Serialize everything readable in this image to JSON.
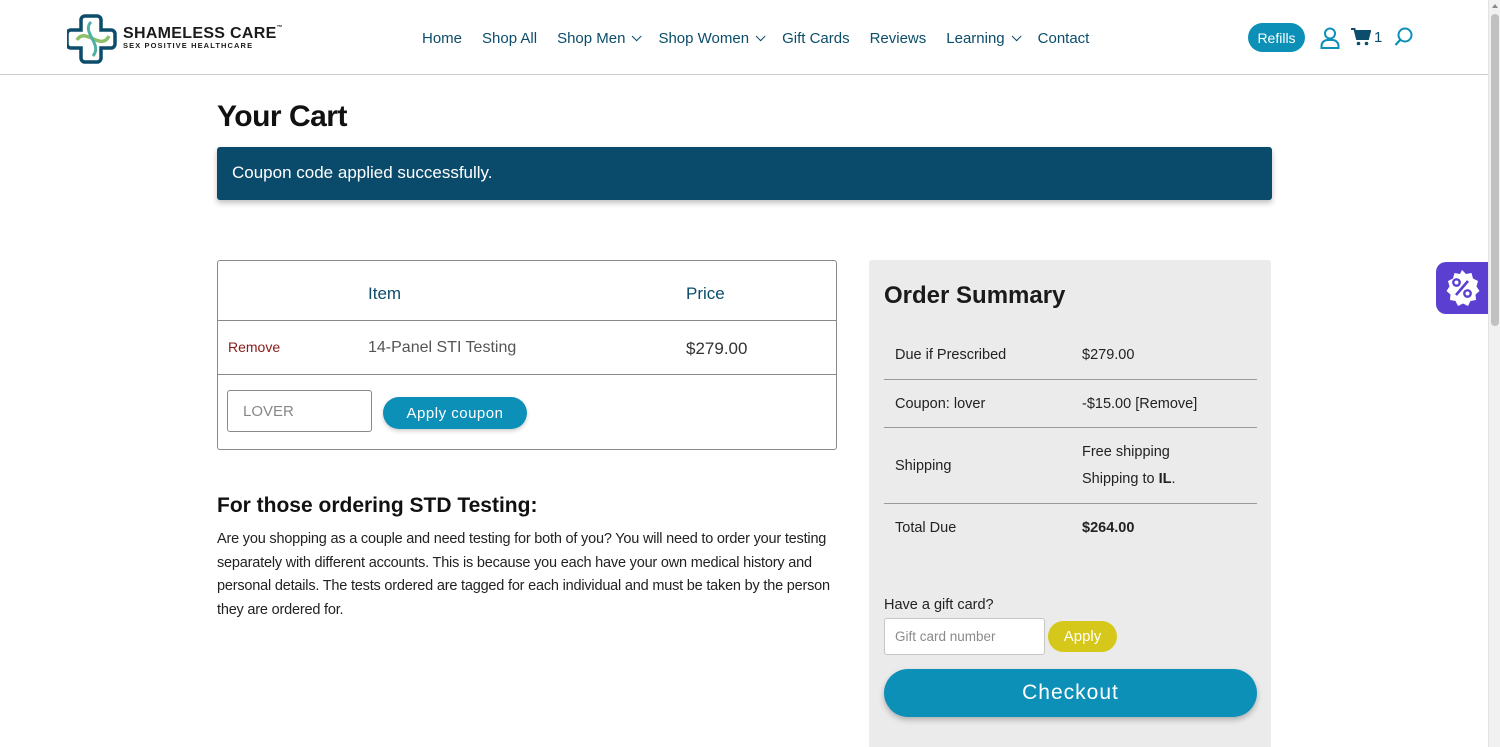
{
  "header": {
    "brand": "SHAMELESS CARE",
    "brand_mark": "™",
    "tagline": "SEX POSITIVE HEALTHCARE",
    "nav": [
      {
        "label": "Home",
        "dropdown": false
      },
      {
        "label": "Shop All",
        "dropdown": false
      },
      {
        "label": "Shop Men",
        "dropdown": true
      },
      {
        "label": "Shop Women",
        "dropdown": true
      },
      {
        "label": "Gift Cards",
        "dropdown": false
      },
      {
        "label": "Reviews",
        "dropdown": false
      },
      {
        "label": "Learning",
        "dropdown": true
      },
      {
        "label": "Contact",
        "dropdown": false
      }
    ],
    "refills_label": "Refills",
    "cart_count": "1",
    "icons": [
      "user-icon",
      "cart-icon",
      "search-icon"
    ]
  },
  "page": {
    "title": "Your Cart",
    "notice": "Coupon code applied successfully."
  },
  "cart": {
    "headers": {
      "item": "Item",
      "price": "Price"
    },
    "rows": [
      {
        "remove_label": "Remove",
        "item": "14-Panel STI Testing",
        "price": "$279.00"
      }
    ],
    "coupon_value": "LOVER",
    "apply_coupon_label": "Apply coupon"
  },
  "std": {
    "heading": "For those ordering STD Testing:",
    "text": "Are you shopping as a couple and need testing for both of you? You will need to order your testing separately with different accounts. This is because you each have your own medical history and personal details. The tests ordered are tagged for each individual and must be taken by the person they are ordered for."
  },
  "summary": {
    "title": "Order Summary",
    "due_label": "Due if Prescribed",
    "due_value": "$279.00",
    "coupon_label": "Coupon: lover",
    "coupon_value": "-$15.00",
    "coupon_remove": "[Remove]",
    "shipping_label": "Shipping",
    "shipping_line1": "Free shipping",
    "shipping_line2_prefix": "Shipping to ",
    "shipping_state": "IL",
    "shipping_line2_suffix": ".",
    "total_label": "Total Due",
    "total_value": "$264.00",
    "gift_label": "Have a gift card?",
    "gift_placeholder": "Gift card number",
    "gift_apply": "Apply",
    "checkout_label": "Checkout"
  },
  "colors": {
    "accent": "#0c90b8",
    "nav_text": "#0b4d6a",
    "notice_bg": "#0a4a6b",
    "gift_apply_bg": "#d5c81a",
    "widget_bg": "#5b3fd1"
  }
}
